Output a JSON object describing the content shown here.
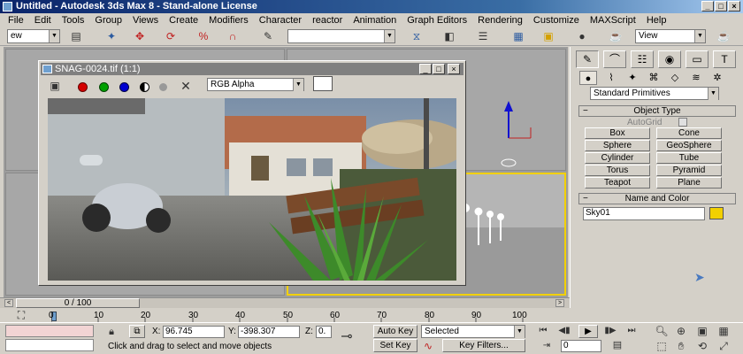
{
  "window": {
    "title": "Untitled - Autodesk 3ds Max 8 - Stand-alone License",
    "controls": [
      "_",
      "□",
      "×"
    ]
  },
  "menu": [
    "File",
    "Edit",
    "Tools",
    "Group",
    "Views",
    "Create",
    "Modifiers",
    "Character",
    "reactor",
    "Animation",
    "Graph Editors",
    "Rendering",
    "Customize",
    "MAXScript",
    "Help"
  ],
  "toolbar": {
    "selection_filter": "ew",
    "named_selection": "",
    "view_combo": "View"
  },
  "render_window": {
    "title": "SNAG-0024.tif (1:1)",
    "channel": "RGB Alpha",
    "controls": [
      "_",
      "□",
      "×"
    ],
    "colors": {
      "red": "#d40000",
      "green": "#00a000",
      "blue": "#0000d0"
    }
  },
  "command_panel": {
    "category": "Standard Primitives",
    "object_type_label": "Object Type",
    "autogrid_label": "AutoGrid",
    "buttons": [
      "Box",
      "Cone",
      "Sphere",
      "GeoSphere",
      "Cylinder",
      "Tube",
      "Torus",
      "Pyramid",
      "Teapot",
      "Plane"
    ],
    "name_color_label": "Name and Color",
    "object_name": "Sky01",
    "object_color": "#f2d000"
  },
  "timeline": {
    "slider_label": "0 / 100",
    "ticks": [
      "0",
      "10",
      "20",
      "30",
      "40",
      "50",
      "60",
      "70",
      "80",
      "90",
      "100"
    ]
  },
  "status": {
    "x_label": "X:",
    "x_value": "96.745",
    "y_label": "Y:",
    "y_value": "-398.307",
    "z_label": "Z:",
    "z_value": "0.",
    "auto_key": "Auto Key",
    "set_key": "Set Key",
    "key_mode": "Selected",
    "key_filters": "Key Filters...",
    "frame": "0",
    "prompt": "Click and drag to select and move objects"
  }
}
